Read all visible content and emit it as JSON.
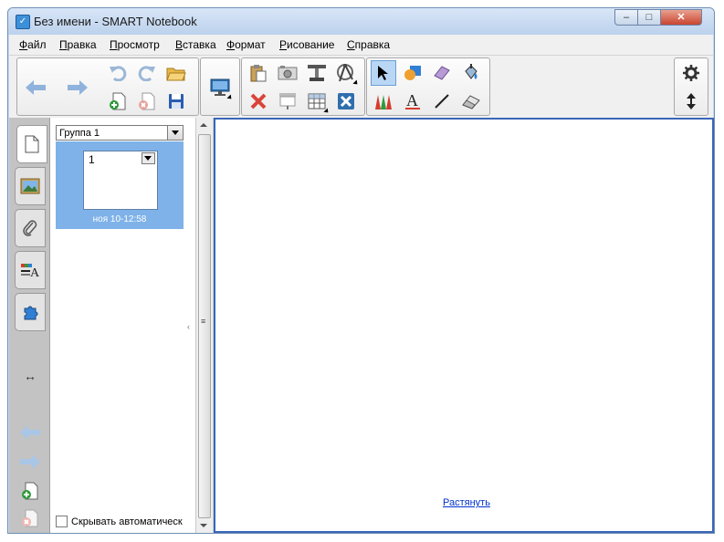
{
  "window": {
    "title": "Без имени - SMART Notebook",
    "controls": {
      "minimize": "‒",
      "maximize": "□",
      "close": "✕"
    }
  },
  "menu": [
    {
      "label": "Файл",
      "accel": "Ф",
      "rest": "айл"
    },
    {
      "label": "Правка",
      "accel": "П",
      "rest": "равка"
    },
    {
      "label": "Просмотр",
      "accel": "П",
      "rest": "росмотр"
    },
    {
      "label": "Вставка",
      "accel": "В",
      "rest": "ставка"
    },
    {
      "label": "Формат",
      "accel": "Ф",
      "rest": "ормат"
    },
    {
      "label": "Рисование",
      "accel": "Р",
      "rest": "исование"
    },
    {
      "label": "Справка",
      "accel": "С",
      "rest": "правка"
    }
  ],
  "toolbar": {
    "icons": {
      "back": "arrow-left-icon",
      "forward": "arrow-right-icon",
      "undo": "undo-icon",
      "redo": "redo-icon",
      "open": "open-folder-icon",
      "add_page": "add-page-icon",
      "delete_page": "delete-page-icon",
      "save": "save-icon",
      "display": "display-screen-icon",
      "paste": "paste-icon",
      "screen_capture": "screen-capture-icon",
      "screen_shade": "screen-shade-icon",
      "measurement": "measurement-tools-icon",
      "delete": "delete-icon",
      "screen_show": "screen-show-icon",
      "table": "table-icon",
      "fullscreen_close": "close-box-icon",
      "select": "select-arrow-icon",
      "shapes": "shapes-icon",
      "creative_pen": "creative-pen-icon",
      "fill": "fill-icon",
      "pens": "pens-icon",
      "text": "text-icon",
      "line": "line-icon",
      "eraser": "eraser-icon",
      "settings": "gear-icon",
      "move_toolbar": "move-toolbar-icon"
    },
    "colors": {
      "accent": "#2f7fd4",
      "delete": "#d9443a",
      "save": "#2a5db0",
      "pen_red": "#d63b2f",
      "pen_green": "#2e9a3a"
    }
  },
  "sidebar": {
    "tabs": [
      {
        "name": "page-sorter-tab",
        "icon": "page-sorter-icon",
        "active": true
      },
      {
        "name": "gallery-tab",
        "icon": "gallery-icon",
        "active": false
      },
      {
        "name": "attachments-tab",
        "icon": "paperclip-icon",
        "active": false
      },
      {
        "name": "properties-tab",
        "icon": "properties-icon",
        "active": false
      },
      {
        "name": "addons-tab",
        "icon": "puzzle-icon",
        "active": false
      }
    ],
    "controls": {
      "move_side": "↔"
    }
  },
  "page_sorter": {
    "group_label": "Группа 1",
    "pages": [
      {
        "number": "1",
        "caption": "ноя 10-12:58"
      }
    ],
    "autohide_label": "Скрывать автоматическ",
    "autohide_checked": false
  },
  "canvas": {
    "stretch_link": "Растянуть"
  }
}
